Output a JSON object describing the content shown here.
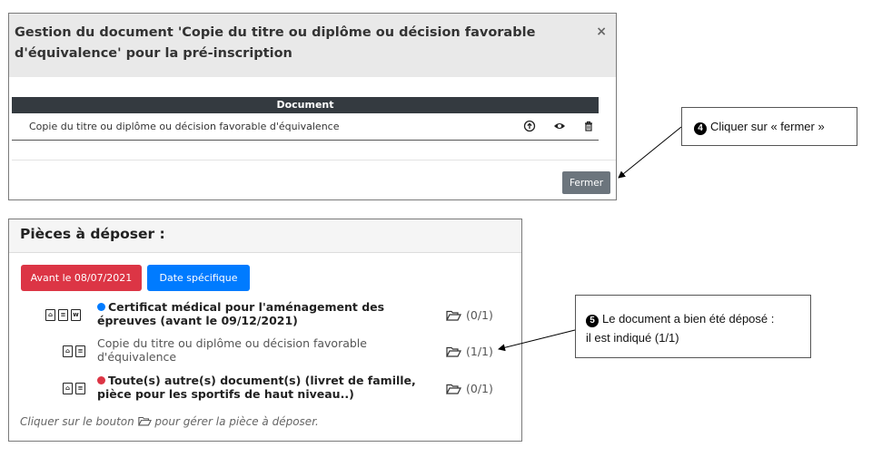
{
  "modal": {
    "title": "Gestion du document 'Copie du titre ou diplôme ou décision favorable d'équivalence' pour la pré-inscription",
    "close_label": "×",
    "table_header": "Document",
    "row": {
      "name": "Copie du titre ou diplôme ou décision favorable d'équivalence",
      "actions": [
        "upload-icon",
        "eye-icon",
        "trash-icon"
      ]
    },
    "close_button": "Fermer"
  },
  "callouts": {
    "step4": {
      "number": "4",
      "text": "Cliquer sur « fermer »"
    },
    "step5": {
      "number": "5",
      "line1": "Le document  a bien été déposé :",
      "line2": "il est indiqué (1/1)"
    }
  },
  "panel": {
    "title": "Pièces à déposer :",
    "tags": {
      "before": "Avant le 08/07/2021",
      "specific": "Date spécifique"
    },
    "items": [
      {
        "label_line1": "Certificat médical pour l'aménagement des",
        "label_line2": "épreuves (avant le 09/12/2021)",
        "count": "(0/1)",
        "dot_color": "#007bff",
        "icons": [
          "pdf-icon",
          "doc-icon",
          "word-icon"
        ]
      },
      {
        "label_line1": "Copie du titre ou diplôme ou décision favorable",
        "label_line2": "d'équivalence",
        "count": "(1/1)",
        "icons": [
          "pdf-icon",
          "doc-icon"
        ]
      },
      {
        "label_line1": "Toute(s) autre(s) document(s) (livret de famille,",
        "label_line2": "pièce pour les sportifs de haut niveau..)",
        "count": "(0/1)",
        "dot_color": "#dc3545",
        "icons": [
          "pdf-icon",
          "doc-icon"
        ]
      }
    ],
    "hint_before": "Cliquer sur le bouton",
    "hint_after": "pour gérer la pièce à déposer."
  },
  "colors": {
    "header_dark": "#343a40",
    "danger": "#dc3545",
    "primary": "#007bff",
    "secondary": "#6c757d"
  }
}
